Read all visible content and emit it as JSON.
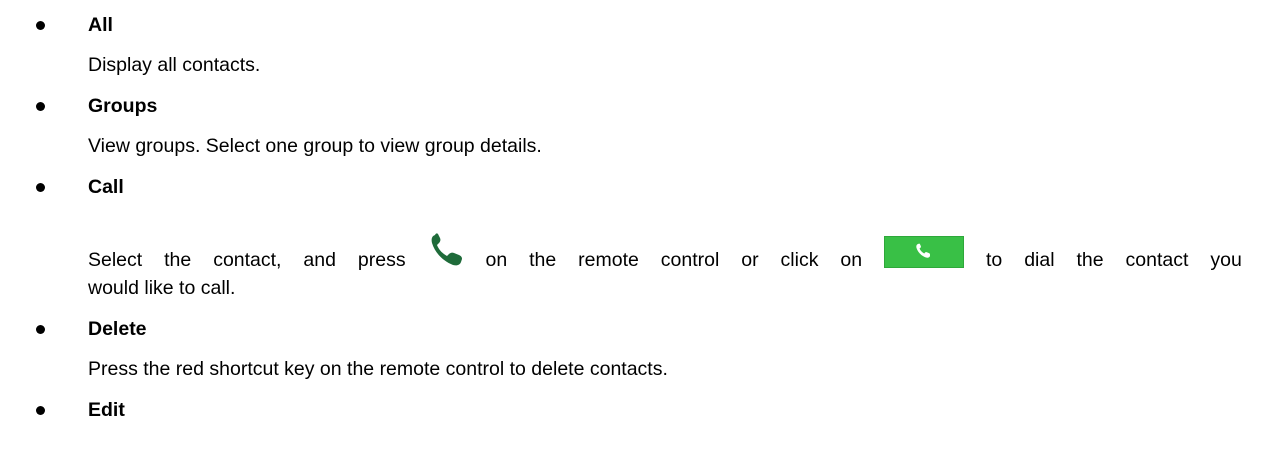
{
  "items": [
    {
      "title": "All",
      "description": "Display all contacts."
    },
    {
      "title": "Groups",
      "description": "View groups. Select one group to view group details."
    },
    {
      "title": "Call",
      "description_parts": {
        "w1": "Select",
        "w2": "the",
        "w3": "contact,",
        "w4": "and",
        "w5": "press",
        "w6": "on",
        "w7": "the",
        "w8": "remote",
        "w9": "control",
        "w10": "or",
        "w11": "click",
        "w12": "on",
        "w13": "to",
        "w14": "dial",
        "w15": "the",
        "w16": "contact",
        "w17": "you"
      },
      "description_line2": "would like to call.",
      "icons": [
        "phone-icon",
        "call-button-icon"
      ]
    },
    {
      "title": "Delete",
      "description": "Press the red shortcut key on the remote control to delete contacts."
    },
    {
      "title": "Edit"
    }
  ],
  "colors": {
    "phone_icon": "#1f6b3a",
    "call_button": "#39c046",
    "call_button_icon": "#ffffff",
    "text": "#000000"
  }
}
